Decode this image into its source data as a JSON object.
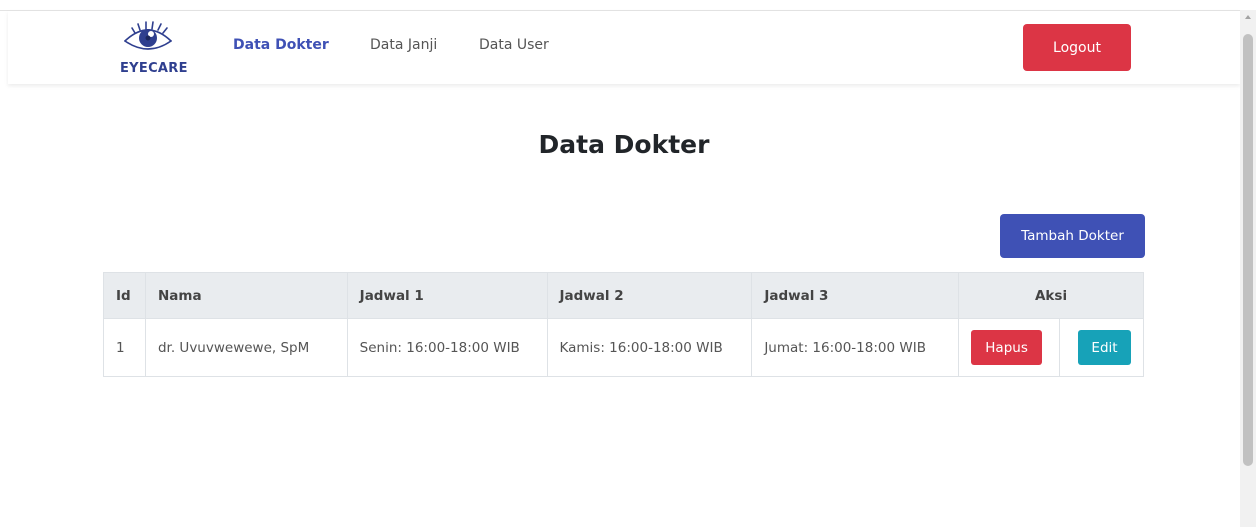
{
  "brand": {
    "name": "EYECARE",
    "logo_icon": "eye-logo-icon",
    "color": "#2f3f8f"
  },
  "nav": {
    "links": [
      {
        "label": "Data Dokter",
        "active": true
      },
      {
        "label": "Data Janji",
        "active": false
      },
      {
        "label": "Data User",
        "active": false
      }
    ],
    "logout_label": "Logout"
  },
  "main": {
    "title": "Data Dokter",
    "add_button_label": "Tambah Dokter"
  },
  "table": {
    "headers": [
      "Id",
      "Nama",
      "Jadwal 1",
      "Jadwal 2",
      "Jadwal 3",
      "Aksi"
    ],
    "rows": [
      {
        "id": "1",
        "nama": "dr. Uvuvwewewe, SpM",
        "jadwal1": "Senin: 16:00-18:00 WIB",
        "jadwal2": "Kamis: 16:00-18:00 WIB",
        "jadwal3": "Jumat: 16:00-18:00 WIB",
        "hapus_label": "Hapus",
        "edit_label": "Edit"
      }
    ]
  },
  "colors": {
    "primary": "#3f51b5",
    "danger": "#dc3545",
    "info": "#17a2b8"
  }
}
